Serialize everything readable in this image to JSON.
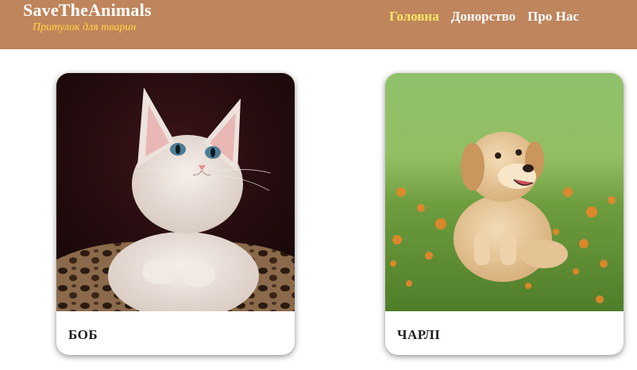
{
  "header": {
    "brand": "SaveTheAnimals",
    "tagline": "Притулок для тварин",
    "nav": [
      {
        "label": "Головна",
        "active": true
      },
      {
        "label": "Донорство",
        "active": false
      },
      {
        "label": "Про Нас",
        "active": false
      }
    ]
  },
  "colors": {
    "header_bg": "#bf855c",
    "tagline": "#ffd640",
    "nav_active": "#ffe866"
  },
  "pets": [
    {
      "name": "БОБ",
      "photo": "kitten-photo"
    },
    {
      "name": "ЧАРЛІ",
      "photo": "puppy-photo"
    }
  ]
}
